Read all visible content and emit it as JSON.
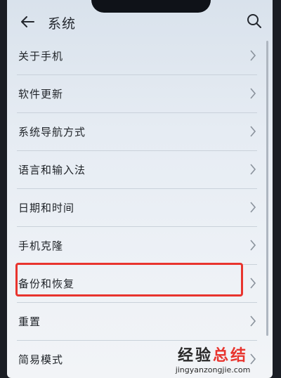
{
  "header": {
    "back_icon": "arrow-left-icon",
    "title": "系统",
    "search_icon": "search-icon"
  },
  "settings": {
    "items": [
      {
        "label": "关于手机"
      },
      {
        "label": "软件更新"
      },
      {
        "label": "系统导航方式"
      },
      {
        "label": "语言和输入法"
      },
      {
        "label": "日期和时间"
      },
      {
        "label": "手机克隆"
      },
      {
        "label": "备份和恢复",
        "highlighted": true
      },
      {
        "label": "重置"
      },
      {
        "label": "简易模式"
      }
    ],
    "chevron_icon": "chevron-right-icon"
  },
  "watermark": {
    "text_part1": "经验",
    "text_part2": "总结",
    "url": "jingyanzongjie.com"
  },
  "colors": {
    "highlight_border": "#e8342e",
    "text": "#1f2328"
  }
}
